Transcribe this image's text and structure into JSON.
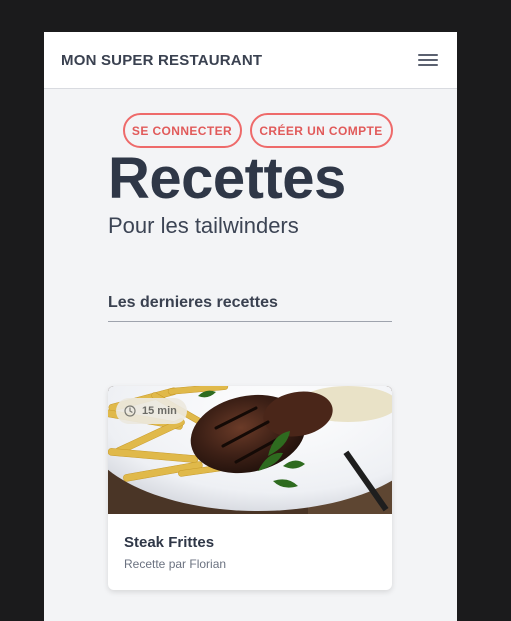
{
  "navbar": {
    "brand": "MON SUPER RESTAURANT",
    "menu_icon": "hamburger-menu-icon"
  },
  "auth": {
    "login_label": "SE CONNECTER",
    "signup_label": "CRÉER UN COMPTE"
  },
  "hero": {
    "title": "Recettes",
    "subtitle": "Pour les tailwinders"
  },
  "latest": {
    "section_title": "Les dernieres recettes",
    "recipes": [
      {
        "title": "Steak Frittes",
        "author": "Recette par Florian",
        "duration": "15 min",
        "duration_icon": "clock-icon",
        "image": "steak-and-fries-photo"
      }
    ]
  },
  "colors": {
    "accent": "#ee6a6a",
    "text": "#2f3747",
    "background": "#f3f4f6",
    "frame": "#1b1b1c"
  }
}
